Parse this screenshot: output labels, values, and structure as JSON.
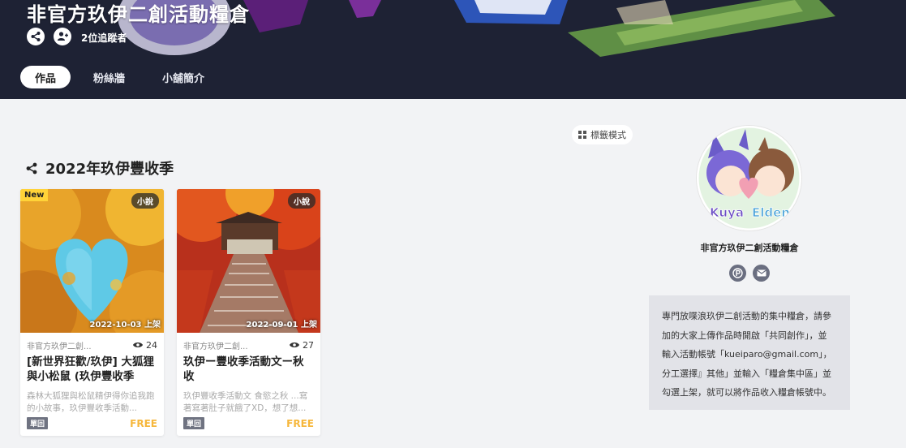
{
  "header": {
    "title": "非官方玖伊二創活動糧倉",
    "followers": "2位追蹤者",
    "tabs": [
      {
        "label": "作品",
        "active": true
      },
      {
        "label": "粉絲牆",
        "active": false
      },
      {
        "label": "小舖簡介",
        "active": false
      }
    ]
  },
  "main": {
    "view_toggle": "標籤模式",
    "section_title": "2022年玖伊豐收季",
    "cards": [
      {
        "badge_new": "New",
        "type": "小說",
        "date": "2022-10-03 上架",
        "author": "非官方玖伊二創...",
        "views": "24",
        "title": "[新世界狂歡/玖伊] 大狐狸與小松鼠 (玖伊豐收季活...",
        "desc": "森林大狐狸與松鼠精伊得你追我跑的小故事，玖伊豐收季活動...",
        "tag": "單回",
        "price": "FREE"
      },
      {
        "type": "小說",
        "date": "2022-09-01 上架",
        "author": "非官方玖伊二創...",
        "views": "27",
        "title": "玖伊ー豐收季活動文ー秋收",
        "desc": "玖伊豐收季活動文 食慾之秋 ...寫著寫著肚子就餓了XD，想了想...",
        "tag": "單回",
        "price": "FREE"
      }
    ]
  },
  "sidebar": {
    "creator_name": "非官方玖伊二創活動糧倉",
    "avatar_text_1": "Kuya",
    "avatar_text_2": "Elden",
    "about_lines": [
      "專門放喋浪玖伊二創活動的集中糧倉，請參",
      "加的大家上傳作品時開啟「共同創作」，並",
      "輸入活動帳號「kueiparo@gmail.com」，",
      "分工選擇』其他」並輸入「糧倉集中區」並",
      "勾選上架，就可以將作品收入糧倉帳號中。"
    ]
  },
  "colors": {
    "header_bg": "#1e2234",
    "page_bg": "#f2f3f5",
    "price": "#f6b73c",
    "new_badge": "#ffd338",
    "tag_bg": "#6f7381",
    "about_bg": "#e2e3e8"
  },
  "icons": [
    "share-icon",
    "follow-icon",
    "grid-icon",
    "eye-icon",
    "p-icon",
    "mail-icon"
  ]
}
